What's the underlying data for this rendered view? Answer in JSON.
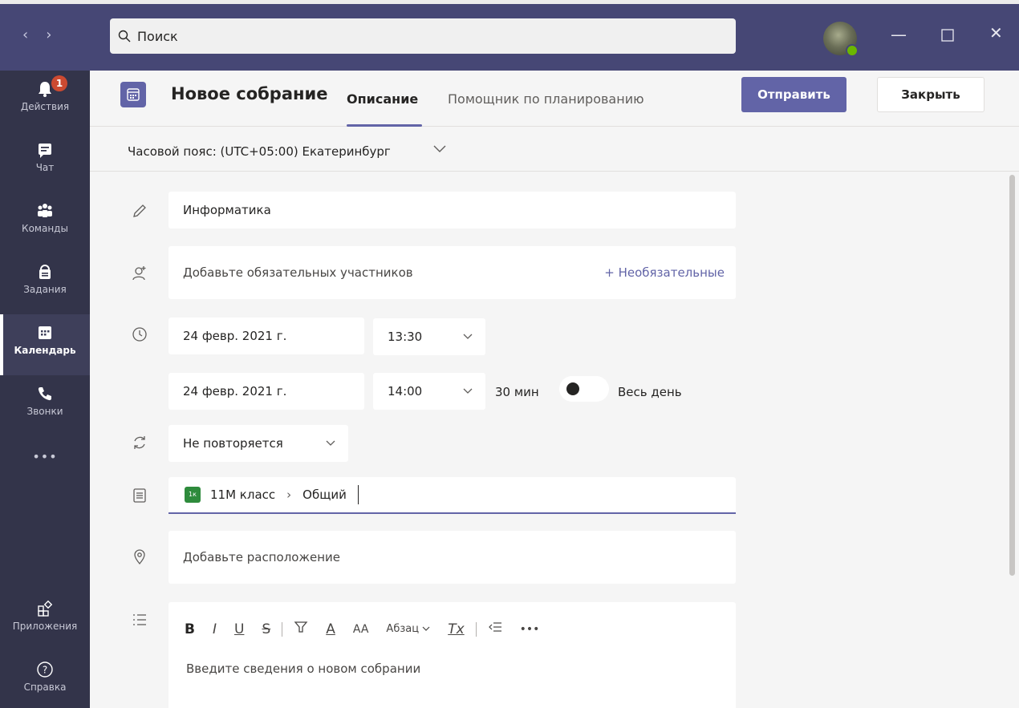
{
  "search": {
    "placeholder": "Поиск"
  },
  "rail": {
    "items": [
      {
        "label": "Действия",
        "icon": "bell-icon",
        "badge": "1"
      },
      {
        "label": "Чат",
        "icon": "chat-icon"
      },
      {
        "label": "Команды",
        "icon": "teams-icon"
      },
      {
        "label": "Задания",
        "icon": "assignments-icon"
      },
      {
        "label": "Календарь",
        "icon": "calendar-icon",
        "active": true
      },
      {
        "label": "Звонки",
        "icon": "phone-icon"
      },
      {
        "label": "•••",
        "icon": "more-icon"
      },
      {
        "label": "Приложения",
        "icon": "apps-icon"
      },
      {
        "label": "Справка",
        "icon": "help-icon"
      }
    ]
  },
  "header": {
    "title": "Новое собрание",
    "tabs": [
      {
        "label": "Описание",
        "active": true
      },
      {
        "label": "Помощник по планированию"
      }
    ],
    "send_label": "Отправить",
    "close_label": "Закрыть"
  },
  "timezone": {
    "label": "Часовой пояс: (UTC+05:00) Екатеринбург"
  },
  "form": {
    "title_value": "Информатика",
    "attendees_placeholder": "Добавьте обязательных участников",
    "optional_link": "+ Необязательные",
    "start_date": "24 февр. 2021 г.",
    "start_time": "13:30",
    "end_date": "24 февр. 2021 г.",
    "end_time": "14:00",
    "duration": "30 мин",
    "all_day_label": "Весь день",
    "all_day_on": false,
    "repeat": "Не повторяется",
    "channel": {
      "team_tile": "1к",
      "team": "11М класс",
      "channel": "Общий"
    },
    "location_placeholder": "Добавьте расположение",
    "editor_placeholder": "Введите сведения о новом собрании",
    "toolbar": {
      "bold": "B",
      "italic": "I",
      "underline": "U",
      "strike": "S",
      "font_color": "A",
      "font_size": "AA",
      "paragraph": "Абзац",
      "clear_format": "Tx",
      "more": "•••"
    }
  },
  "colors": {
    "accent": "#6264a7",
    "titlebar": "#464775",
    "rail": "#33344a",
    "badge": "#cc4a31",
    "presence": "#6bb700"
  }
}
